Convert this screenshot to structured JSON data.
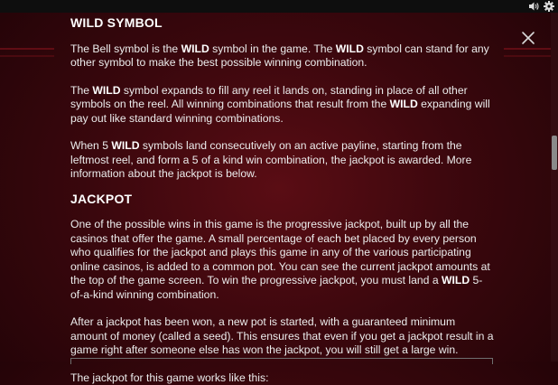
{
  "sections": [
    {
      "heading": "WILD SYMBOL",
      "paragraphs": [
        {
          "p1_a": "The Bell symbol is the ",
          "p1_b": "WILD",
          "p1_c": " symbol in the game. The ",
          "p1_d": "WILD",
          "p1_e": " symbol can stand for any other symbol to make the best possible winning combination."
        },
        {
          "p2_a": "The ",
          "p2_b": "WILD",
          "p2_c": " symbol expands to fill any reel it lands on, standing in place of all other symbols on the reel. All winning combinations that result from the ",
          "p2_d": "WILD",
          "p2_e": " expanding will pay out like standard winning combinations."
        },
        {
          "p3_a": "When 5 ",
          "p3_b": "WILD",
          "p3_c": " symbols land consecutively on an active payline, starting from the leftmost reel, and form a 5 of a kind win combination, the jackpot is awarded. More information about the jackpot is below."
        }
      ]
    },
    {
      "heading": "JACKPOT",
      "paragraphs": [
        {
          "p4_a": "One of the possible wins in this game is the progressive jackpot, built up by all the casinos that offer the game. A small percentage of each bet placed by every person who qualifies for the jackpot and plays this game in any of the various participating online casinos, is added to a common pot. You can see the current jackpot amounts at the top of the game screen. To win the progressive jackpot, you must land a ",
          "p4_b": "WILD",
          "p4_c": " 5-of-a-kind winning combination."
        },
        {
          "p5": "After a jackpot has been won, a new pot is started, with a guaranteed minimum amount of money (called a seed). This ensures that even if you get a jackpot result in a game right after someone else has won the jackpot, you will still get a large win."
        },
        {
          "p6": "The jackpot for this game works like this:"
        }
      ]
    }
  ],
  "icons": {
    "sound": "speaker-icon",
    "settings": "gear-icon",
    "close": "close-icon"
  },
  "colors": {
    "background": "#3a070d",
    "text": "#ececec",
    "heading": "#ffffff"
  }
}
